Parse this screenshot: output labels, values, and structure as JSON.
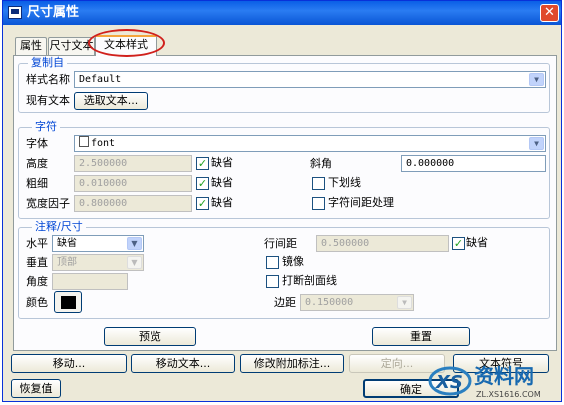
{
  "window": {
    "title": "尺寸属性",
    "close_glyph": "✕"
  },
  "tabs": [
    {
      "label": "属性",
      "active": false
    },
    {
      "label": "尺寸文本",
      "active": false
    },
    {
      "label": "文本样式",
      "active": true
    }
  ],
  "copy_from": {
    "legend": "复制自",
    "style_name_label": "样式名称",
    "style_name_value": "Default",
    "existing_text_label": "现有文本",
    "select_text_button": "选取文本..."
  },
  "character": {
    "legend": "字符",
    "font_label": "字体",
    "font_value": "font",
    "height_label": "高度",
    "height_value": "2.500000",
    "height_default": true,
    "thickness_label": "粗细",
    "thickness_value": "0.010000",
    "thickness_default": true,
    "width_factor_label": "宽度因子",
    "width_factor_value": "0.800000",
    "width_factor_default": true,
    "default_label": "缺省",
    "slant_label": "斜角",
    "slant_value": "0.000000",
    "underline_label": "下划线",
    "underline_checked": false,
    "kerning_label": "字符间距处理",
    "kerning_checked": false
  },
  "note_dimension": {
    "legend": "注释/尺寸",
    "horizontal_label": "水平",
    "horizontal_value": "缺省",
    "vertical_label": "垂直",
    "vertical_value": "顶部",
    "angle_label": "角度",
    "angle_value": "",
    "color_label": "颜色",
    "color_value": "#000000",
    "line_spacing_label": "行间距",
    "line_spacing_value": "0.500000",
    "line_spacing_default_label": "缺省",
    "line_spacing_default": true,
    "mirror_label": "镜像",
    "mirror_checked": false,
    "break_hatch_label": "打断剖面线",
    "break_hatch_checked": false,
    "margin_label": "边距",
    "margin_value": "0.150000"
  },
  "panel_buttons": {
    "preview": "预览",
    "reset": "重置"
  },
  "actions": {
    "move": "移动...",
    "move_text": "移动文本...",
    "modify_attach": "修改附加标注...",
    "orient": "定向...",
    "text_symbol": "文本符号"
  },
  "footer": {
    "restore": "恢复值",
    "ok": "确定"
  },
  "watermark": {
    "text": "资料网",
    "url": "ZL.XS1616.COM",
    "mark": "XS"
  }
}
